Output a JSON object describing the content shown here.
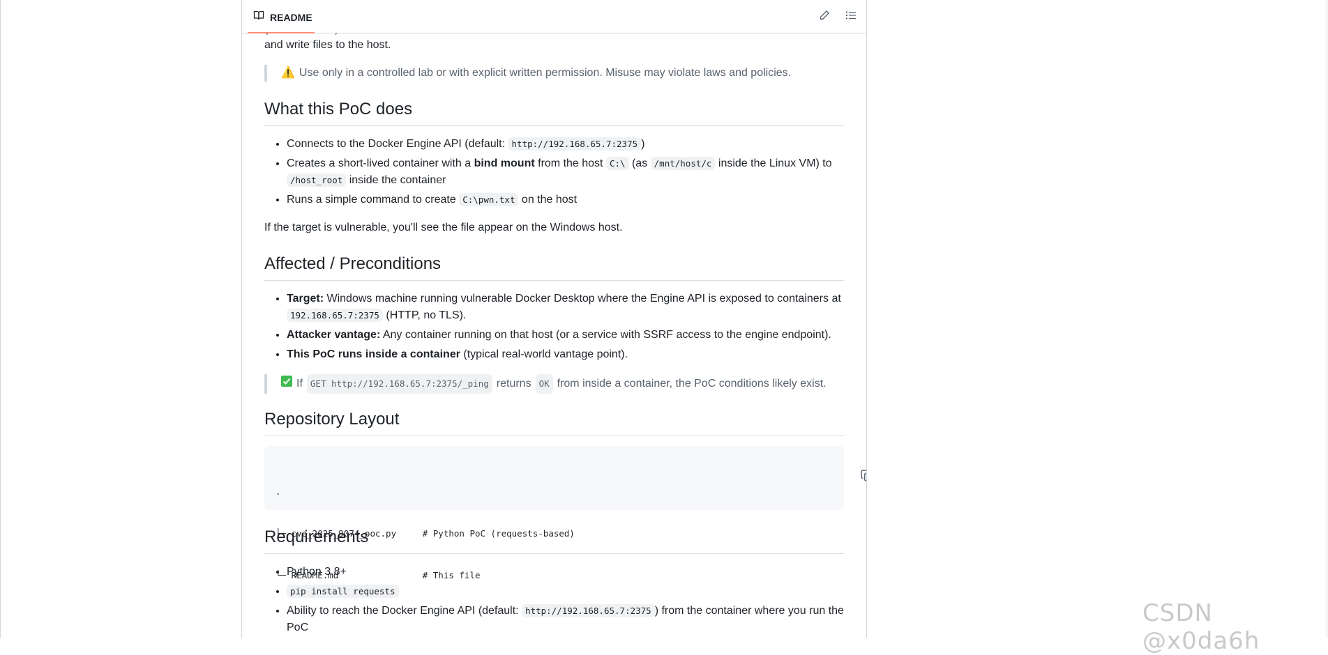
{
  "header": {
    "tab_label": "README",
    "icons": [
      "book-icon",
      "pencil-icon",
      "list-icon"
    ]
  },
  "top_cut_text": "and write files to the host.",
  "warning": {
    "emoji": "⚠️",
    "text": "Use only in a controlled lab or with explicit written permission. Misuse may violate laws and policies."
  },
  "section1": {
    "title": "What this PoC does",
    "items": [
      {
        "pre": "Connects to the Docker Engine API (default: ",
        "code": "http://192.168.65.7:2375",
        "post": ")"
      },
      {
        "pre": "Creates a short-lived container with a ",
        "bold": "bind mount",
        "mid": " from the host ",
        "code1": "C:\\",
        "mid2": " (as ",
        "code2": "/mnt/host/c",
        "mid3": " inside the Linux VM) to ",
        "code3": "/host_root",
        "post": " inside the container"
      },
      {
        "pre": "Runs a simple command to create ",
        "code": "C:\\pwn.txt",
        "post": " on the host"
      }
    ],
    "after": "If the target is vulnerable, you'll see the file appear on the Windows host."
  },
  "section2": {
    "title": "Affected / Preconditions",
    "items": [
      {
        "bold": "Target:",
        "text": " Windows machine running vulnerable Docker Desktop where the Engine API is exposed to containers at ",
        "code": "192.168.65.7:2375",
        "post": " (HTTP, no TLS)."
      },
      {
        "bold": "Attacker vantage:",
        "text": " Any container running on that host (or a service with SSRF access to the engine endpoint)."
      },
      {
        "bold": "This PoC runs inside a container",
        "text": " (typical real-world vantage point)."
      }
    ],
    "note": {
      "pre": "If ",
      "code1": "GET http://192.168.65.7:2375/_ping",
      "mid": " returns ",
      "code2": "OK",
      "post": " from inside a container, the PoC conditions likely exist."
    }
  },
  "section3": {
    "title": "Repository Layout",
    "code_lines": [
      ".",
      "├─ cve_2025_9074_poc.py     # Python PoC (requests-based)",
      "└─ README.md                # This file"
    ]
  },
  "section4": {
    "title": "Requirements",
    "items": [
      {
        "text": "Python 3.8+"
      },
      {
        "code": "pip install requests"
      },
      {
        "pre": "Ability to reach the Docker Engine API (default: ",
        "code": "http://192.168.65.7:2375",
        "post": ") from the container where you run the PoC"
      }
    ]
  },
  "watermark": "CSDN @x0da6h"
}
